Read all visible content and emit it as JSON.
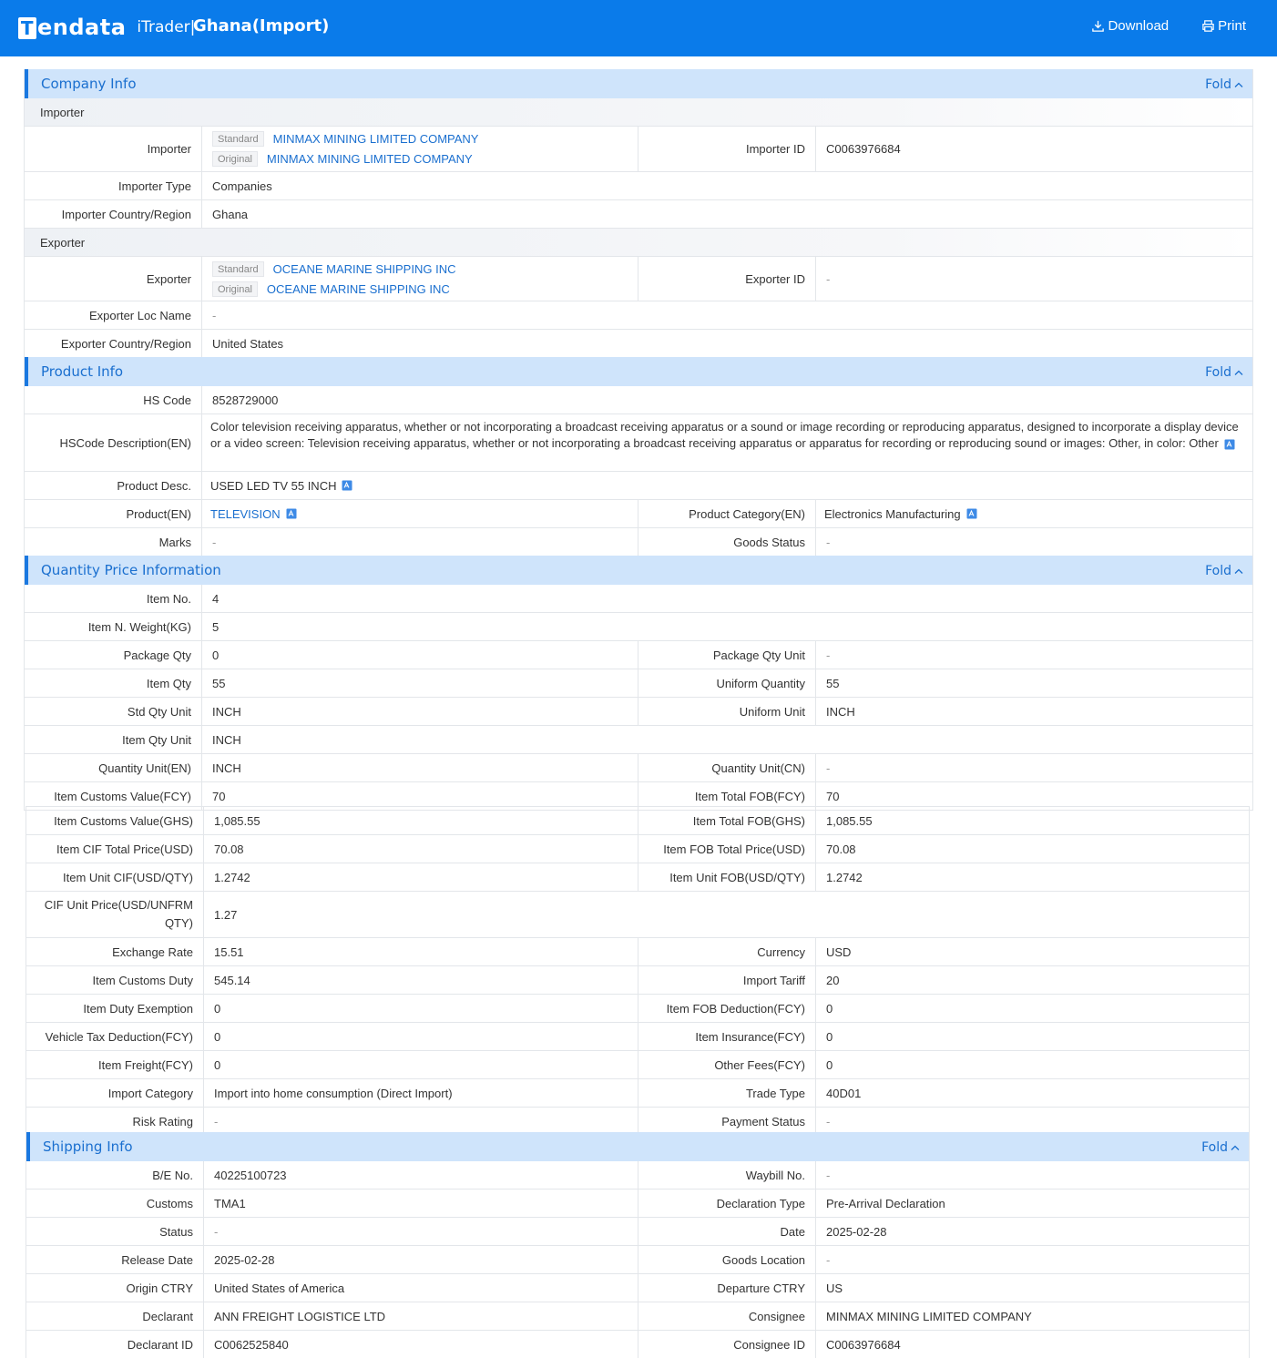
{
  "header": {
    "logo_mark": "T",
    "logo_rest": "endata",
    "logo_sub": "iTrader|",
    "title": "Ghana(Import)",
    "download_label": "Download",
    "print_label": "Print",
    "accent": "#0a7bea"
  },
  "fold_label": "Fold",
  "tags": {
    "standard": "Standard",
    "original": "Original"
  },
  "company": {
    "title": "Company Info",
    "importer_sub": "Importer",
    "importer_label": "Importer",
    "importer_std": "MINMAX MINING LIMITED COMPANY",
    "importer_orig": "MINMAX MINING LIMITED COMPANY",
    "importer_id_label": "Importer ID",
    "importer_id": "C0063976684",
    "importer_type_label": "Importer Type",
    "importer_type": "Companies",
    "importer_country_label": "Importer Country/Region",
    "importer_country": "Ghana",
    "exporter_sub": "Exporter",
    "exporter_label": "Exporter",
    "exporter_std": "OCEANE MARINE SHIPPING INC",
    "exporter_orig": "OCEANE MARINE SHIPPING INC",
    "exporter_id_label": "Exporter ID",
    "exporter_id": "-",
    "exporter_loc_label": "Exporter Loc Name",
    "exporter_loc": "-",
    "exporter_country_label": "Exporter Country/Region",
    "exporter_country": "United States"
  },
  "product": {
    "title": "Product Info",
    "hs_label": "HS Code",
    "hs": "8528729000",
    "hsdesc_label": "HSCode Description(EN)",
    "hsdesc": "Color television receiving apparatus, whether or not incorporating a broadcast receiving apparatus or a sound or image recording or reproducing apparatus, designed to incorporate a display device or a video screen: Television receiving apparatus, whether or not incorporating a broadcast receiving apparatus or apparatus for recording or reproducing sound or images: Other, in color: Other",
    "desc_label": "Product Desc.",
    "desc": "USED LED TV 55 INCH",
    "product_en_label": "Product(EN)",
    "product_en": "TELEVISION",
    "category_label": "Product Category(EN)",
    "category": "Electronics Manufacturing",
    "marks_label": "Marks",
    "marks": "-",
    "goods_status_label": "Goods Status",
    "goods_status": "-"
  },
  "quantity": {
    "title": "Quantity Price Information",
    "rows": [
      {
        "l1": "Item No.",
        "v1": "4"
      },
      {
        "l1": "Item N. Weight(KG)",
        "v1": "5"
      },
      {
        "l1": "Package Qty",
        "v1": "0",
        "l2": "Package Qty Unit",
        "v2": "-"
      },
      {
        "l1": "Item Qty",
        "v1": "55",
        "l2": "Uniform Quantity",
        "v2": "55"
      },
      {
        "l1": "Std Qty Unit",
        "v1": "INCH",
        "l2": "Uniform Unit",
        "v2": "INCH"
      },
      {
        "l1": "Item Qty Unit",
        "v1": "INCH"
      },
      {
        "l1": "Quantity Unit(EN)",
        "v1": "INCH",
        "l2": "Quantity Unit(CN)",
        "v2": "-"
      },
      {
        "l1": "Item Customs Value(FCY)",
        "v1": "70",
        "l2": "Item Total FOB(FCY)",
        "v2": "70"
      }
    ],
    "rows_b": [
      {
        "l1": "Item Customs Value(GHS)",
        "v1": "1,085.55",
        "l2": "Item Total FOB(GHS)",
        "v2": "1,085.55"
      },
      {
        "l1": "Item CIF Total Price(USD)",
        "v1": "70.08",
        "l2": "Item FOB Total Price(USD)",
        "v2": "70.08"
      },
      {
        "l1": "Item Unit CIF(USD/QTY)",
        "v1": "1.2742",
        "l2": "Item Unit FOB(USD/QTY)",
        "v2": "1.2742"
      },
      {
        "l1": "CIF Unit Price(USD/UNFRM QTY)",
        "v1": "1.27"
      },
      {
        "l1": "Exchange Rate",
        "v1": "15.51",
        "l2": "Currency",
        "v2": "USD"
      },
      {
        "l1": "Item Customs Duty",
        "v1": "545.14",
        "l2": "Import Tariff",
        "v2": "20"
      },
      {
        "l1": "Item Duty Exemption",
        "v1": "0",
        "l2": "Item FOB Deduction(FCY)",
        "v2": "0"
      },
      {
        "l1": "Vehicle Tax Deduction(FCY)",
        "v1": "0",
        "l2": "Item Insurance(FCY)",
        "v2": "0"
      },
      {
        "l1": "Item Freight(FCY)",
        "v1": "0",
        "l2": "Other Fees(FCY)",
        "v2": "0"
      },
      {
        "l1": "Import Category",
        "v1": "Import into home consumption (Direct Import)",
        "l2": "Trade Type",
        "v2": "40D01"
      },
      {
        "l1": "Risk Rating",
        "v1": "-",
        "l2": "Payment Status",
        "v2": "-"
      }
    ]
  },
  "shipping": {
    "title": "Shipping Info",
    "rows": [
      {
        "l1": "B/E No.",
        "v1": "40225100723",
        "l2": "Waybill No.",
        "v2": "-"
      },
      {
        "l1": "Customs",
        "v1": "TMA1",
        "l2": "Declaration Type",
        "v2": "Pre-Arrival Declaration"
      },
      {
        "l1": "Status",
        "v1": "-",
        "l2": "Date",
        "v2": "2025-02-28"
      },
      {
        "l1": "Release Date",
        "v1": "2025-02-28",
        "l2": "Goods Location",
        "v2": "-"
      },
      {
        "l1": "Origin CTRY",
        "v1": "United States of America",
        "l2": "Departure CTRY",
        "v2": "US"
      },
      {
        "l1": "Declarant",
        "v1": "ANN FREIGHT LOGISTICE LTD",
        "l2": "Consignee",
        "v2": "MINMAX MINING LIMITED COMPANY"
      },
      {
        "l1": "Declarant ID",
        "v1": "C0062525840",
        "l2": "Consignee ID",
        "v2": "C0063976684"
      }
    ]
  }
}
